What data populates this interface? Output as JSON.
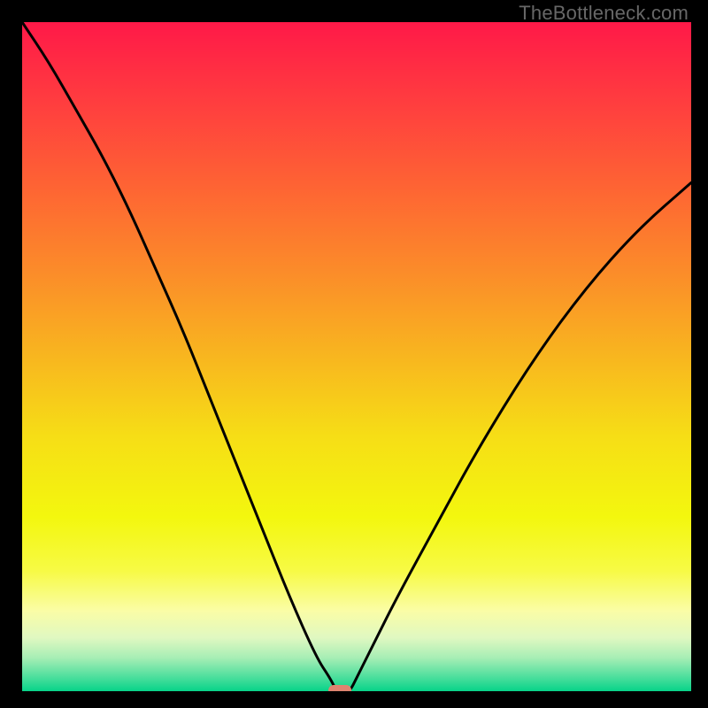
{
  "watermark": "TheBottleneck.com",
  "chart_data": {
    "type": "line",
    "title": "",
    "xlabel": "",
    "ylabel": "",
    "xlim": [
      0,
      100
    ],
    "ylim": [
      0,
      100
    ],
    "legend": false,
    "grid": false,
    "background_gradient": {
      "stops": [
        {
          "offset": 0.0,
          "color": "#FF1948"
        },
        {
          "offset": 0.12,
          "color": "#FF3D3F"
        },
        {
          "offset": 0.25,
          "color": "#FE6533"
        },
        {
          "offset": 0.38,
          "color": "#FB8E29"
        },
        {
          "offset": 0.5,
          "color": "#F8B61F"
        },
        {
          "offset": 0.62,
          "color": "#F6DE16"
        },
        {
          "offset": 0.74,
          "color": "#F3F70E"
        },
        {
          "offset": 0.82,
          "color": "#F7FA45"
        },
        {
          "offset": 0.88,
          "color": "#FAFDA6"
        },
        {
          "offset": 0.92,
          "color": "#E0F8C1"
        },
        {
          "offset": 0.95,
          "color": "#A7EEB5"
        },
        {
          "offset": 0.98,
          "color": "#49DE9C"
        },
        {
          "offset": 1.0,
          "color": "#07D389"
        }
      ]
    },
    "series": [
      {
        "name": "bottleneck-curve",
        "x": [
          0,
          4,
          8,
          12,
          16,
          20,
          24,
          28,
          32,
          36,
          40,
          44,
          46,
          47,
          48,
          49,
          50,
          52,
          56,
          62,
          68,
          76,
          84,
          92,
          100
        ],
        "y": [
          100,
          94,
          87,
          80,
          72,
          63,
          54,
          44,
          34,
          24,
          14,
          5,
          2,
          0,
          0,
          0,
          2,
          6,
          14,
          25,
          36,
          49,
          60,
          69,
          76
        ]
      }
    ],
    "marker": {
      "x": 47.5,
      "y": 0,
      "color": "#DE8470"
    }
  }
}
